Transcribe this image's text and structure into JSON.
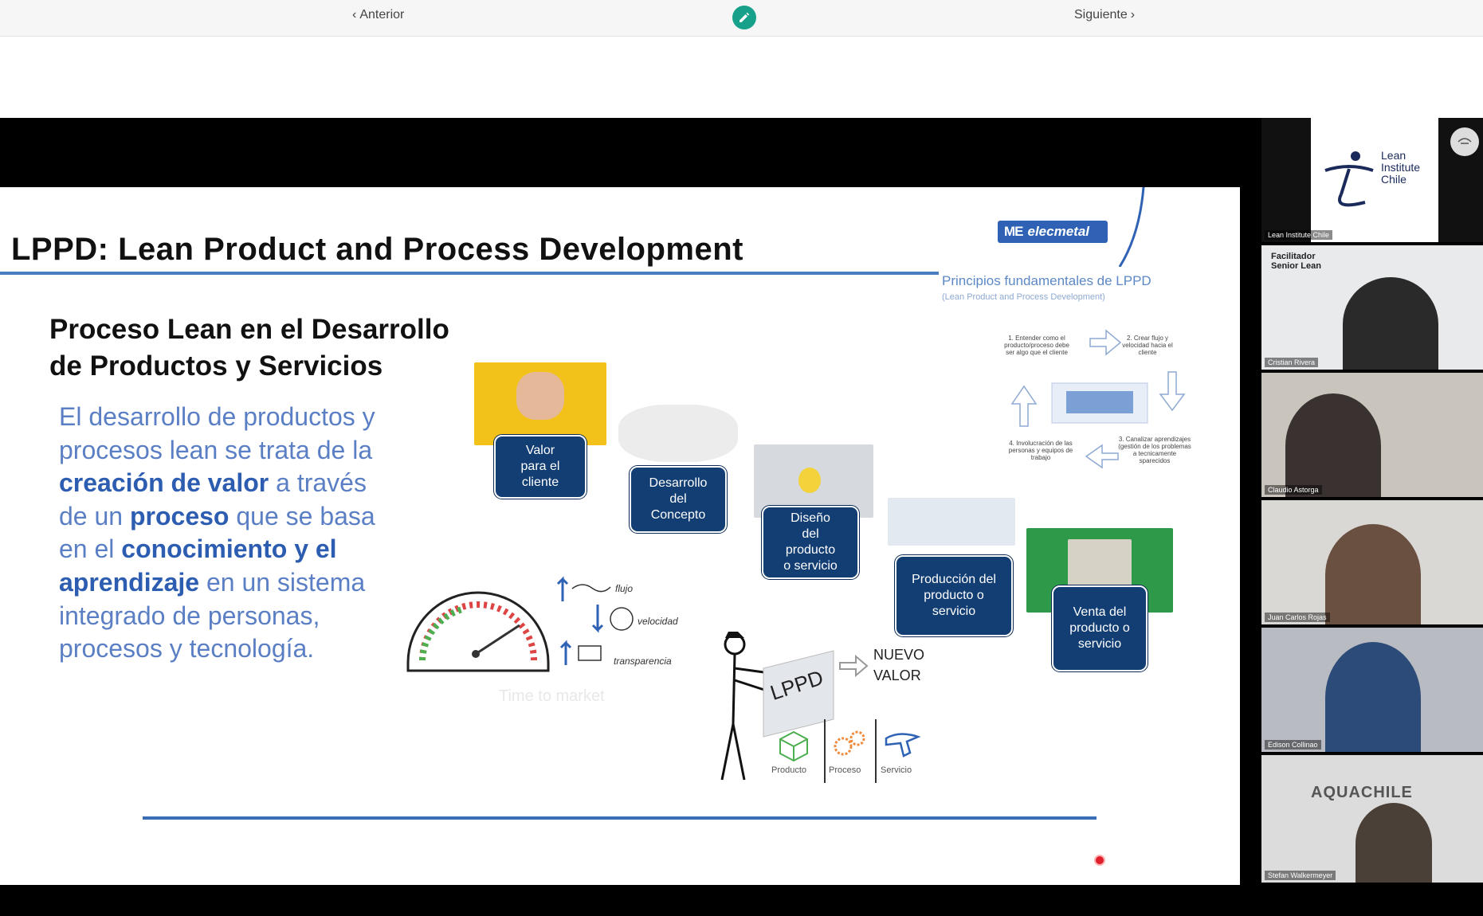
{
  "nav": {
    "prev_label": "Anterior",
    "next_label": "Siguiente",
    "prev_icon": "chevron-left-icon",
    "next_icon": "chevron-right-icon",
    "edit_icon": "pencil-icon",
    "accent": "#17a08a"
  },
  "slide": {
    "title": "LPPD: Lean Product and Process Development",
    "brand": "elecmetal",
    "subtitle": "Proceso Lean en el Desarrollo\nde Productos y Servicios",
    "body": {
      "p1": "El desarrollo de productos y procesos lean se trata de la",
      "b1": "creación de valor",
      "p2": " a través de  un ",
      "b2": "proceso",
      "p3": " que se basa en el ",
      "b3": "conocimiento y el aprendizaje",
      "p4": " en un sistema integrado de personas, procesos y tecnología."
    },
    "steps": [
      {
        "label": "Valor para el cliente"
      },
      {
        "label": "Desarrollo del Concepto"
      },
      {
        "label": "Diseño del producto o servicio"
      },
      {
        "label": "Producción del producto o servicio"
      },
      {
        "label": "Venta del producto o servicio"
      }
    ],
    "principles": {
      "title": "Principios fundamentales de LPPD",
      "subtitle": "(Lean Product and Process Development)",
      "items": [
        "1. Entender como el producto/proceso debe ser algo que el cliente",
        "2. Crear flujo y velocidad hacia el cliente",
        "3. Canalizar aprendizajes (gestión de los problemas a tecnicamente sparecidos",
        "4. Involucración de las personas y equipos de trabajo"
      ]
    },
    "lppd_label": "LPPD",
    "nuevo_valor": "NUEVO\nVALOR",
    "flow_labels": [
      "flujo",
      "velocidad",
      "transparencia"
    ],
    "time_to_market": "Time to market",
    "icons": [
      {
        "label": "Producto"
      },
      {
        "label": "Proceso"
      },
      {
        "label": "Servicio"
      }
    ],
    "brand_color": "#2f62b5",
    "step_color": "#123e74"
  },
  "participants": [
    {
      "name": "Lean Institute Chile",
      "logo_text": "Lean\nInstitute\nChile"
    },
    {
      "name": "Cristian Rivera",
      "tag": "Facilitador\nSenior Lean"
    },
    {
      "name": "Claudio Astorga"
    },
    {
      "name": "Juan Carlos Rojas"
    },
    {
      "name": "Edison Collinao"
    },
    {
      "name": "Stefan Walkermeyer",
      "logo_text": "AQUACHILE"
    }
  ]
}
